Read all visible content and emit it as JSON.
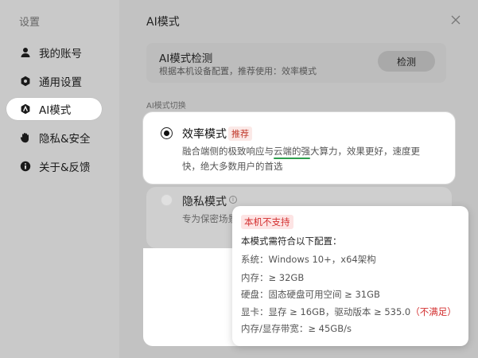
{
  "sidebar": {
    "title": "设置",
    "items": [
      {
        "label": "我的账号",
        "icon": "user-icon"
      },
      {
        "label": "通用设置",
        "icon": "gear-icon"
      },
      {
        "label": "AI模式",
        "icon": "ai-icon",
        "active": true
      },
      {
        "label": "隐私&安全",
        "icon": "hand-icon"
      },
      {
        "label": "关于&反馈",
        "icon": "info-icon"
      }
    ]
  },
  "main": {
    "title": "AI模式",
    "detect": {
      "title": "AI模式检测",
      "subtitle": "根据本机设备配置，推荐使用：效率模式",
      "button": "检测"
    },
    "section_label": "AI模式切换",
    "efficiency": {
      "title": "效率模式",
      "tag": "推荐",
      "desc_before": "融合端侧的极致响应与",
      "desc_underlined": "云端的强",
      "desc_after": "大算力，效果更好，速度更快，绝大多数用户的首选",
      "selected": true
    },
    "privacy": {
      "title": "隐私模式",
      "desc": "专为保密场景和分析",
      "selected": false
    }
  },
  "tooltip": {
    "badge": "本机不支持",
    "heading": "本模式需符合以下配置：",
    "system": "系统：Windows 10+，x64架构",
    "memory": "内存：≥ 32GB",
    "disk": "硬盘：固态硬盘可用空间 ≥ 31GB",
    "gpu": "显卡：显存 ≥ 16GB，驱动版本 ≥ 535.0",
    "gpu_warn": "（不满足）",
    "bandwidth": "内存/显存带宽：≥ 45GB/s"
  },
  "colors": {
    "accent_red": "#d32f2f",
    "underline_green": "#2e9d4c"
  }
}
